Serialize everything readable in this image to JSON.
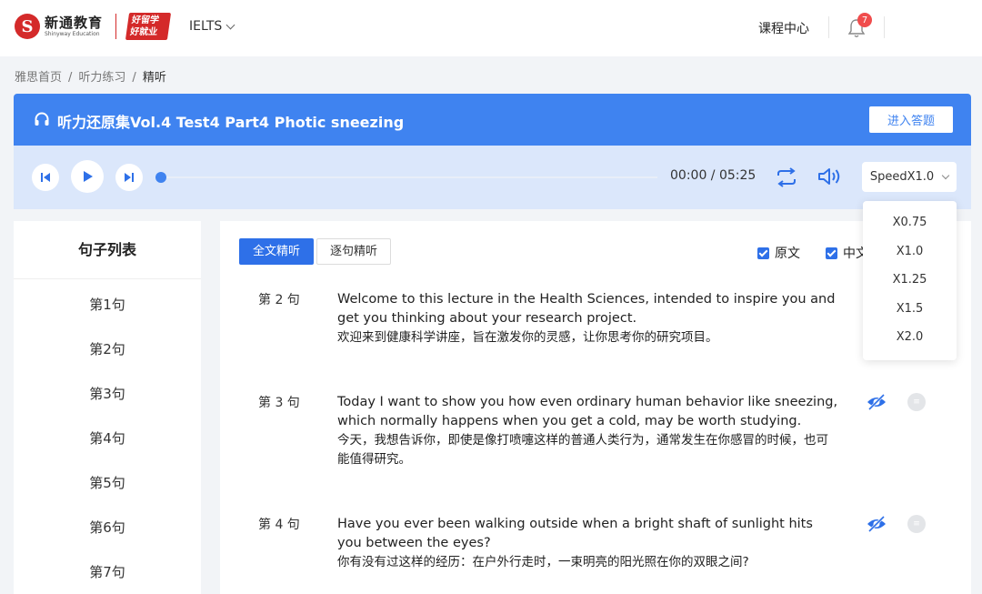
{
  "nav": {
    "logo_cn": "新通教育",
    "logo_en": "Shinyway Education",
    "slogan_line1": "好留学",
    "slogan_line2": "好就业",
    "exam": "IELTS",
    "course_center": "课程中心",
    "notification_count": "7"
  },
  "breadcrumb": {
    "items": [
      "雅思首页",
      "听力练习",
      "精听"
    ],
    "separator": "/"
  },
  "title": {
    "text": "听力还原集Vol.4 Test4 Part4 Photic sneezing",
    "enter_button": "进入答题"
  },
  "player": {
    "time": "00:00 / 05:25",
    "progress": 0,
    "speed_label": "SpeedX1.0",
    "speed_options": [
      "X0.75",
      "X1.0",
      "X1.25",
      "X1.5",
      "X2.0"
    ]
  },
  "sidebar": {
    "title": "句子列表",
    "items": [
      "第1句",
      "第2句",
      "第3句",
      "第4句",
      "第5句",
      "第6句",
      "第7句"
    ]
  },
  "main": {
    "tab_full": "全文精听",
    "tab_sentence": "逐句精听",
    "check_original": "原文",
    "check_chinese": "中文",
    "sentences": [
      {
        "num": "第 2 句",
        "en": "Welcome to this lecture in the Health Sciences, intended to inspire you and get you thinking about your research project.",
        "cn": "欢迎来到健康科学讲座，旨在激发你的灵感，让你思考你的研究项目。"
      },
      {
        "num": "第 3 句",
        "en": "Today I want to show you how even ordinary human behavior like sneezing, which normally happens when you get a cold, may be worth studying.",
        "cn": "今天，我想告诉你，即使是像打喷嚏这样的普通人类行为，通常发生在你感冒的时候，也可能值得研究。"
      },
      {
        "num": "第 4 句",
        "en": "Have you ever been walking outside when a bright shaft of sunlight hits you between the eyes?",
        "cn": "你有没有过这样的经历：在户外行走时，一束明亮的阳光照在你的双眼之间?"
      }
    ]
  },
  "colors": {
    "primary": "#3f83f0",
    "player_bg": "#dbe7fb",
    "brand_red": "#d42a2a",
    "badge": "#f04c4c"
  }
}
